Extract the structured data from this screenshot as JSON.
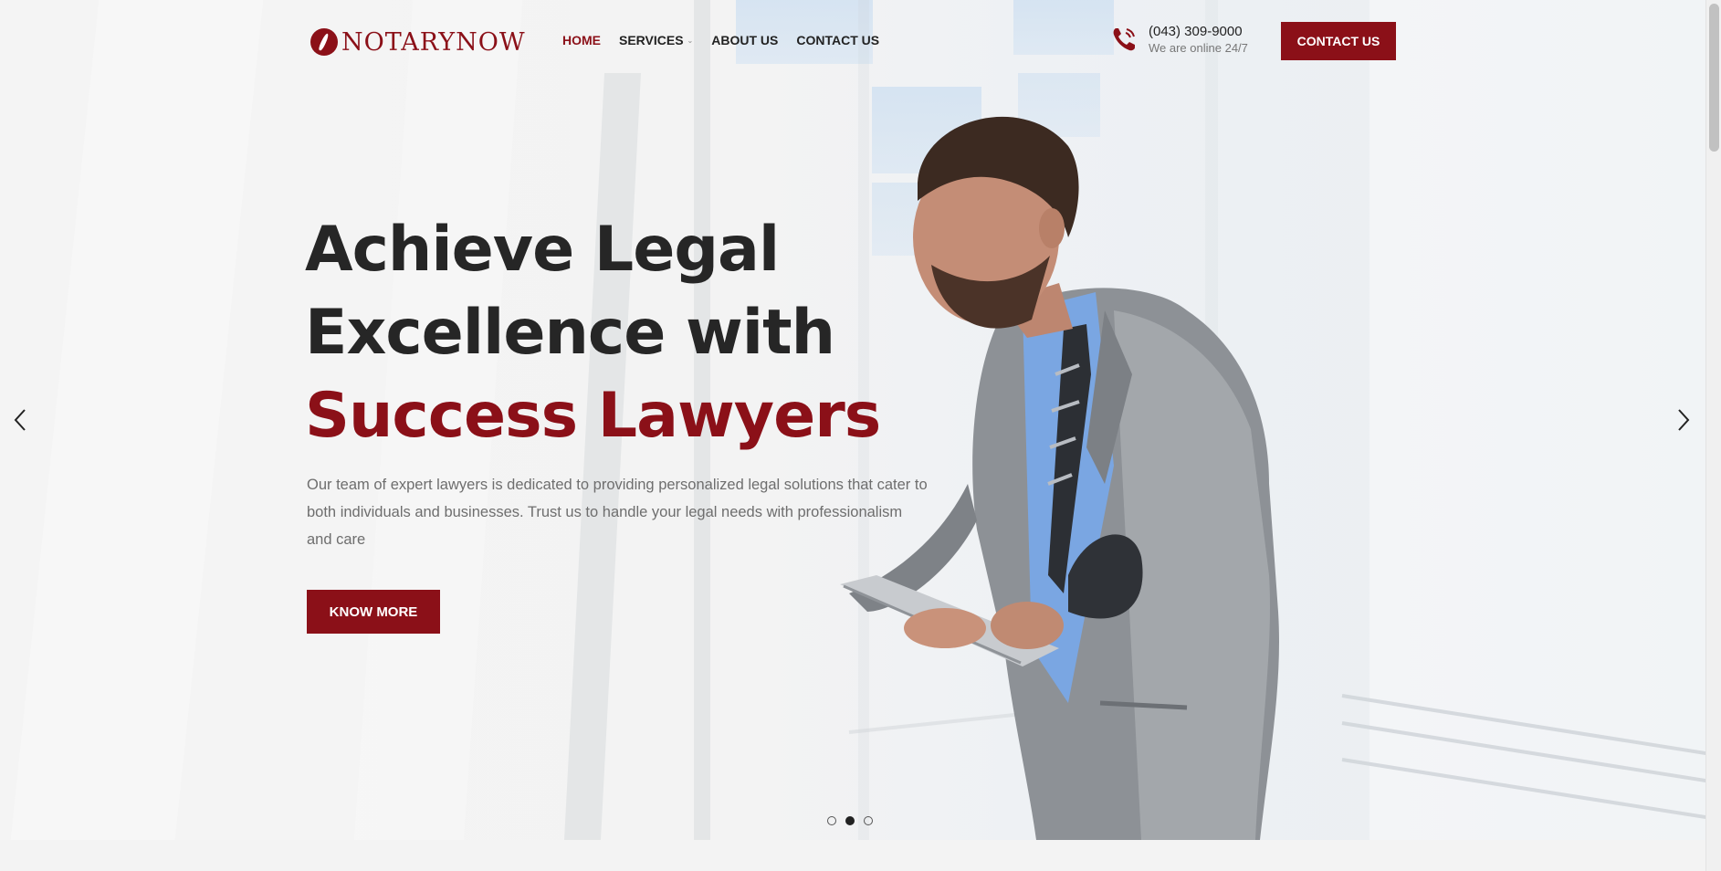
{
  "header": {
    "logo_text": "NOTARYNOW",
    "nav": [
      {
        "label": "HOME",
        "active": true
      },
      {
        "label": "SERVICES",
        "has_dropdown": true
      },
      {
        "label": "ABOUT US"
      },
      {
        "label": "CONTACT US"
      }
    ],
    "phone_number": "(043) 309-9000",
    "phone_status": "We are online 24/7",
    "contact_button": "CONTACT US"
  },
  "hero": {
    "headline_line1": "Achieve Legal",
    "headline_line2": "Excellence with",
    "headline_line3": "Success Lawyers",
    "description": "Our team of expert lawyers is dedicated to providing personalized legal solutions that cater to both individuals and businesses. Trust us to handle your legal needs with professionalism and care",
    "cta_button": "KNOW MORE",
    "slides_count": 3,
    "active_slide": 2
  },
  "icons": {
    "logo": "quill-logo-icon",
    "phone": "phone-icon",
    "prev": "chevron-left-icon",
    "next": "chevron-right-icon",
    "dropdown": "chevron-down-icon"
  },
  "colors": {
    "brand": "#8b1018",
    "heading": "#262626",
    "body_text": "#6e6e6e"
  }
}
